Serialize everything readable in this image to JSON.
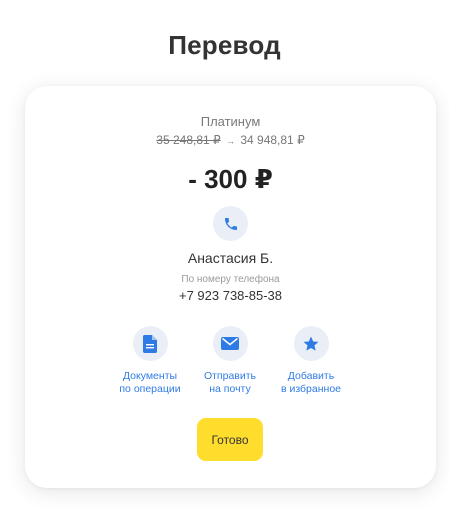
{
  "header": {
    "title": "Перевод"
  },
  "account": {
    "name": "Платинум",
    "balance_before": "35 248,81 ₽",
    "balance_arrow": "→",
    "balance_after": "34 948,81 ₽"
  },
  "transfer": {
    "amount": "- 300 ₽"
  },
  "recipient": {
    "name": "Анастасия Б.",
    "method_caption": "По номеру телефона",
    "phone": "+7 923 738-85-38"
  },
  "actions": [
    {
      "label": "Документы\nпо операции",
      "icon": "document-icon"
    },
    {
      "label": "Отправить\nна почту",
      "icon": "envelope-icon"
    },
    {
      "label": "Добавить\nв избранное",
      "icon": "star-icon"
    }
  ],
  "done_button": {
    "label": "Готово"
  },
  "colors": {
    "accent_blue": "#2f7be5",
    "icon_bg": "#e9eef7",
    "button_yellow": "#ffdd2d"
  }
}
